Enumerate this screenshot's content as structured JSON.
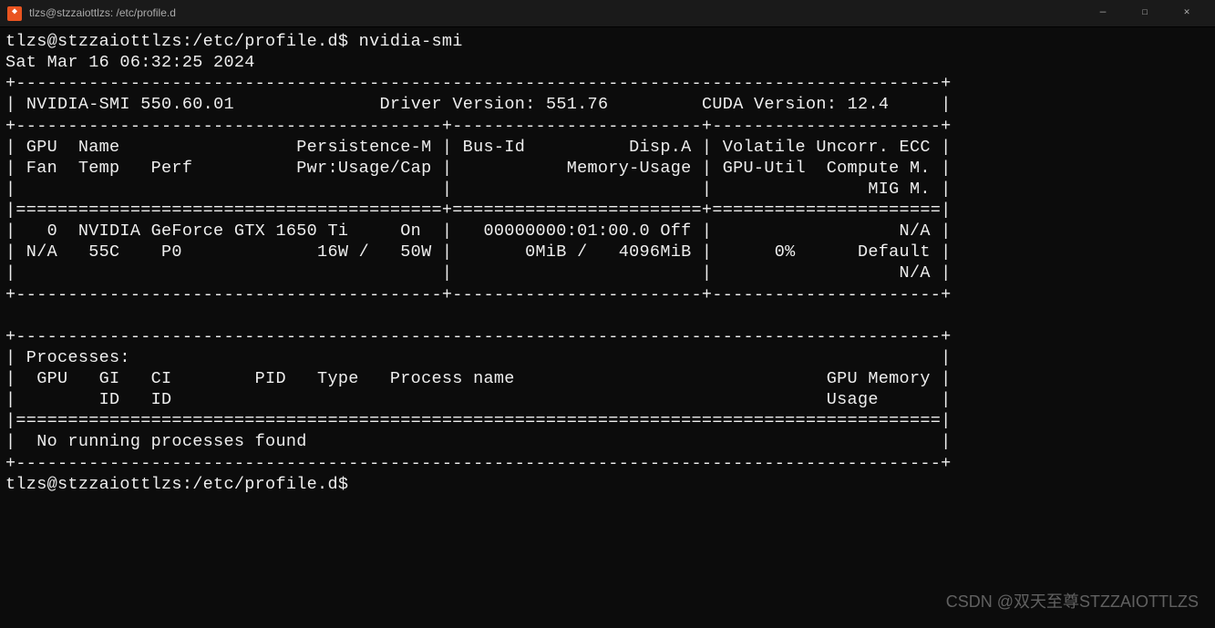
{
  "window": {
    "title": "tlzs@stzzaiottlzs: /etc/profile.d",
    "minimize_label": "—",
    "maximize_label": "☐",
    "close_label": "✕"
  },
  "prompt1": {
    "user_host_path": "tlzs@stzzaiottlzs:/etc/profile.d$",
    "command": "nvidia-smi"
  },
  "timestamp": "Sat Mar 16 06:32:25 2024",
  "header": {
    "smi_version_label": "NVIDIA-SMI",
    "smi_version": "550.60.01",
    "driver_label": "Driver Version:",
    "driver_version": "551.76",
    "cuda_label": "CUDA Version:",
    "cuda_version": "12.4"
  },
  "columns": {
    "r1": "| GPU  Name                 Persistence-M | Bus-Id          Disp.A | Volatile Uncorr. ECC |",
    "r2": "| Fan  Temp   Perf          Pwr:Usage/Cap |           Memory-Usage | GPU-Util  Compute M. |",
    "r3": "|                                         |                        |               MIG M. |"
  },
  "gpu_row": {
    "r1": "|   0  NVIDIA GeForce GTX 1650 Ti     On  |   00000000:01:00.0 Off |                  N/A |",
    "r2": "| N/A   55C    P0             16W /   50W |       0MiB /   4096MiB |      0%      Default |",
    "r3": "|                                         |                        |                  N/A |"
  },
  "processes": {
    "h1": "| Processes:                                                                              |",
    "h2": "|  GPU   GI   CI        PID   Type   Process name                              GPU Memory |",
    "h3": "|        ID   ID                                                               Usage      |",
    "none": "|  No running processes found                                                             |"
  },
  "borders": {
    "top": "+-----------------------------------------------------------------------------------------+",
    "sep3": "+-----------------------------------------+------------------------+----------------------+",
    "eq3": "|=========================================+========================+======================|",
    "proc_top": "+-----------------------------------------------------------------------------------------+",
    "proc_eq": "|=========================================================================================|",
    "proc_bottom": "+-----------------------------------------------------------------------------------------+"
  },
  "prompt2": {
    "user_host_path": "tlzs@stzzaiottlzs:/etc/profile.d$"
  },
  "watermark": "CSDN @双天至尊STZZAIOTTLZS"
}
